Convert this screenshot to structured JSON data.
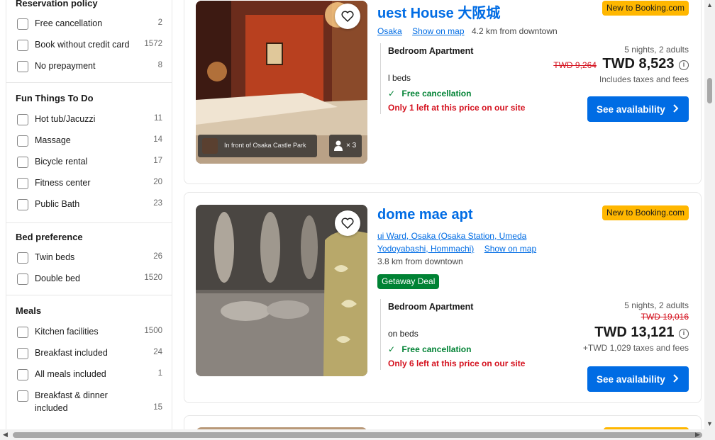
{
  "sidebar": {
    "reservation_policy": {
      "title": "Reservation policy",
      "items": [
        {
          "label": "Free cancellation",
          "count": "2"
        },
        {
          "label": "Book without credit card",
          "count": "1572"
        },
        {
          "label": "No prepayment",
          "count": "8"
        }
      ]
    },
    "fun_things": {
      "title": "Fun Things To Do",
      "items": [
        {
          "label": "Hot tub/Jacuzzi",
          "count": "11"
        },
        {
          "label": "Massage",
          "count": "14"
        },
        {
          "label": "Bicycle rental",
          "count": "17"
        },
        {
          "label": "Fitness center",
          "count": "20"
        },
        {
          "label": "Public Bath",
          "count": "23"
        }
      ]
    },
    "bed_preference": {
      "title": "Bed preference",
      "items": [
        {
          "label": "Twin beds",
          "count": "26"
        },
        {
          "label": "Double bed",
          "count": "1520"
        }
      ]
    },
    "meals": {
      "title": "Meals",
      "items": [
        {
          "label": "Kitchen facilities",
          "count": "1500"
        },
        {
          "label": "Breakfast included",
          "count": "24"
        },
        {
          "label": "All meals included",
          "count": "1"
        },
        {
          "label": "Breakfast & dinner",
          "label2": "included",
          "count": "15"
        }
      ]
    }
  },
  "cards": [
    {
      "title": "uest House 大阪城",
      "badge": "New to Booking.com",
      "location": "Osaka",
      "show_on_map": "Show on map",
      "distance": "4.2 km from downtown",
      "photo_caption": "In front of Osaka Castle Park",
      "photo_people": "× 3",
      "room_name": "Bedroom Apartment",
      "room_beds": "l beds",
      "free_cancellation": "Free cancellation",
      "availability_warning": "Only 1 left at this price on our site",
      "nights": "5 nights, 2 adults",
      "old_price": "TWD 9,264",
      "price": "TWD 8,523",
      "taxes": "Includes taxes and fees",
      "button": "See availability"
    },
    {
      "title": "dome mae apt",
      "badge": "New to Booking.com",
      "location_line1": "ui Ward, Osaka (Osaka Station, Umeda",
      "location_line2": "Yodoyabashi, Hommachi)",
      "show_on_map": "Show on map",
      "distance": "3.8 km from downtown",
      "deal": "Getaway Deal",
      "room_name": "Bedroom Apartment",
      "room_beds": "on beds",
      "free_cancellation": "Free cancellation",
      "availability_warning": "Only 6 left at this price on our site",
      "nights": "5 nights, 2 adults",
      "old_price": "TWD 19,016",
      "price": "TWD 13,121",
      "taxes": "+TWD 1,029 taxes and fees",
      "button": "See availability"
    }
  ],
  "colors": {
    "brand_blue": "#006ce4",
    "badge_yellow": "#ffb700",
    "success_green": "#008234",
    "warning_red": "#d4111e"
  }
}
